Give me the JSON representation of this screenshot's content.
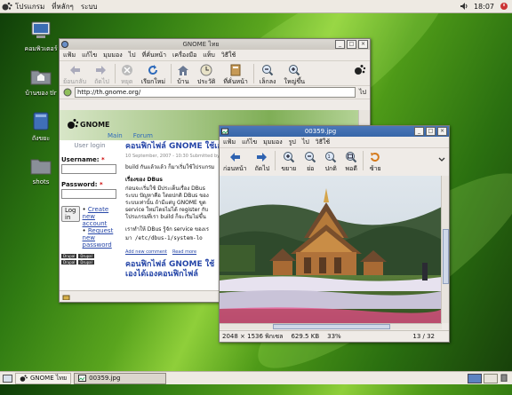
{
  "top_panel": {
    "menus": [
      "โปรแกรม",
      "ที่หลักๆ",
      "ระบบ"
    ],
    "clock": "18:07"
  },
  "desktop_icons": [
    {
      "label": "คอมพิวเตอร์",
      "icon": "computer-icon"
    },
    {
      "label": "บ้านของ tlr",
      "icon": "home-folder-icon"
    },
    {
      "label": "ถังขยะ",
      "icon": "trash-icon"
    },
    {
      "label": "shots",
      "icon": "folder-icon"
    }
  ],
  "browser": {
    "title": "GNOME ไทย",
    "menu": [
      "แฟ้ม",
      "แก้ไข",
      "มุมมอง",
      "ไป",
      "ที่คั่นหน้า",
      "เครื่องมือ",
      "แท็บ",
      "วิธีใช้"
    ],
    "toolbar": [
      "ย้อนกลับ",
      "ถัดไป",
      "หยุด",
      "เรียกใหม่",
      "บ้าน",
      "ประวัติ",
      "ที่คั่นหน้า",
      "เล็กลง",
      "ใหญ่ขึ้น"
    ],
    "url": "http://th.gnome.org/",
    "go_label": "ไป",
    "nav_tabs": [
      "Main",
      "Forum"
    ],
    "logo_text": "GNOME",
    "login": {
      "heading": "User login",
      "username_label": "Username:",
      "password_label": "Password:",
      "login_button": "Log in",
      "links": [
        "Create new account",
        "Request new password"
      ],
      "required_mark": "*"
    },
    "article1": {
      "title": "คอนฟิกไฟล์ GNOME ใช้เองได้ใช้โปรแกรม",
      "meta": "10 September, 2007 - 10:30  Submitted by th",
      "build_intro": "build กันแล้วแล้ว ก็มาเริ่มใช้โปรแกรม",
      "section": "เรื่องของ DBus",
      "body": [
        "ก่อนจะเริ่มใช้ มีประเด็นเรื่อง DBus",
        "ระบบ ปัญหาคือ โดยปกติ DBus ของ",
        "ระบบเท่านั้น ถ้ามีแต่บู GNOME ขูด",
        "service ใหม่โดยไม่ได้ register กับ",
        "โปรแกรมที่เรา build ก็จะเริ่มไม่ขึ้น"
      ],
      "config_line": "เราทำให้ DBus รู้จัก service ของเร",
      "config_path": "มา /etc/dbus-1/system-lo",
      "links": [
        "Add new comment",
        "Read more"
      ]
    },
    "article2_title": "คอนฟิกไฟล์ GNOME ใช้เองได้เองคอนฟิกไฟล์",
    "badges": [
      "Drupal",
      "Drupal",
      "Drupal",
      "Drupal"
    ],
    "scroll_fraction": 0.3
  },
  "viewer": {
    "title": "00359.jpg",
    "menu": [
      "แฟ้ม",
      "แก้ไข",
      "มุมมอง",
      "รูป",
      "ไป",
      "วิธีใช้"
    ],
    "toolbar": [
      "ก่อนหน้า",
      "ถัดไป",
      "ขยาย",
      "ย่อ",
      "ปกติ",
      "พอดี",
      "ซ้าย"
    ],
    "status": {
      "dimensions": "2048 × 1536 พิกเซล",
      "size": "629.5 KB",
      "zoom": "33%",
      "position": "13 / 32"
    }
  },
  "taskbar": {
    "items": [
      "GNOME ไทย",
      "00359.jpg"
    ],
    "active_index": 1
  }
}
